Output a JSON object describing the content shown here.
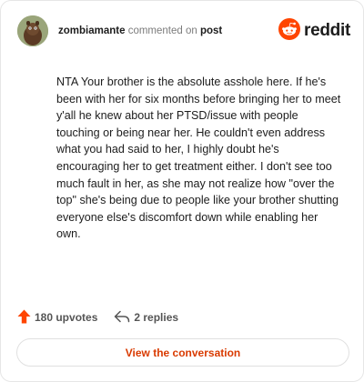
{
  "header": {
    "username": "zombiamante",
    "action_text": "commented on",
    "post_link": "post",
    "brand": "reddit"
  },
  "comment": {
    "text": "NTA Your brother is the absolute asshole here. If he's been with her for six months before bringing her to meet y'all he knew about her PTSD/issue with people touching or being near her. He couldn't even address what you had said to her, I highly doubt he's encouraging her to get treatment either. I don't see too much fault in her, as she may not realize how \"over the top\" she's being due to people like your brother shutting everyone else's discomfort down while enabling her own."
  },
  "footer": {
    "upvotes": "180 upvotes",
    "replies": "2 replies"
  },
  "cta": {
    "label": "View the conversation"
  },
  "colors": {
    "brand_orange": "#ff4500",
    "upvote_arrow": "#ff4500",
    "cta_text": "#d93a00"
  },
  "icons": {
    "avatar": "avatar",
    "logo": "reddit-snoo-icon",
    "upvote": "upvote-arrow-icon",
    "reply": "reply-arrow-icon"
  }
}
